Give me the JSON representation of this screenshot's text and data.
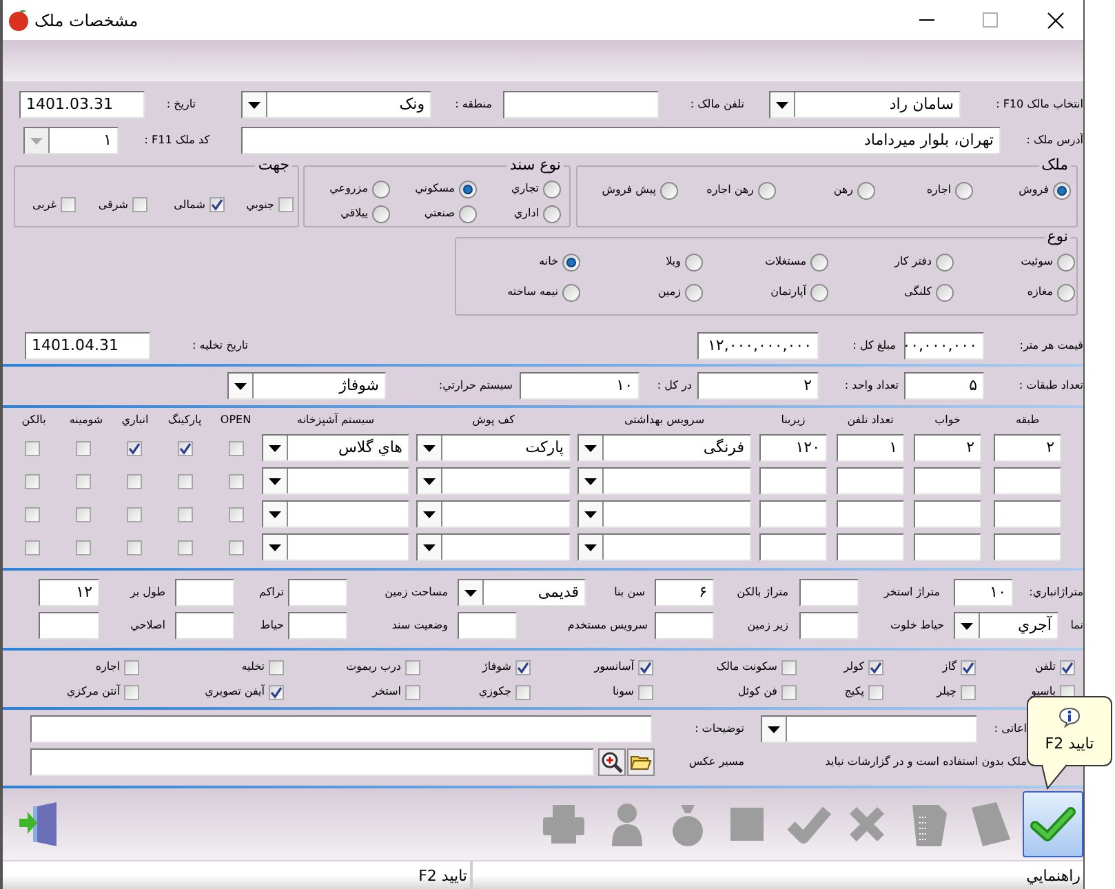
{
  "window": {
    "title": "مشخصات ملک"
  },
  "header": {
    "owner_line": [
      {
        "kind": "label",
        "text": "انتخاب مالک F10 :"
      },
      {
        "kind": "combo",
        "value": "سامان راد"
      },
      {
        "kind": "label",
        "text": "تلفن مالک :"
      },
      {
        "kind": "readonly"
      },
      {
        "kind": "label",
        "text": "منطقه :"
      },
      {
        "kind": "combo",
        "value": "ونک"
      },
      {
        "kind": "label",
        "text": "تاریخ :"
      },
      {
        "kind": "date",
        "value": "1401.03.31"
      }
    ],
    "address_line": [
      {
        "kind": "label",
        "text": "آدرس ملک :"
      },
      {
        "kind": "field",
        "value": "تهران، بلوار میرداماد"
      },
      {
        "kind": "label",
        "text": "کد ملک F11 :"
      },
      {
        "kind": "code",
        "value": "۱"
      }
    ]
  },
  "deal_group": {
    "title": "ملک",
    "options": [
      {
        "label": "فروش",
        "selected": true
      },
      {
        "label": "اجاره",
        "selected": false
      },
      {
        "label": "رهن",
        "selected": false
      },
      {
        "label": "رهن اجاره",
        "selected": false
      },
      {
        "label": "پیش فروش",
        "selected": false
      }
    ]
  },
  "document_group": {
    "title": "نوع سند",
    "options": [
      {
        "label": "تجاري",
        "selected": false
      },
      {
        "label": "مسکوني",
        "selected": true
      },
      {
        "label": "مزروعي",
        "selected": false
      },
      {
        "label": "اداري",
        "selected": false
      },
      {
        "label": "صنعتي",
        "selected": false
      },
      {
        "label": "ييلاقي",
        "selected": false
      }
    ]
  },
  "direction_group": {
    "title": "جهت",
    "options": [
      {
        "label": "جنوبي",
        "checked": false
      },
      {
        "label": "شمالی",
        "checked": true
      },
      {
        "label": "شرقی",
        "checked": false
      },
      {
        "label": "غربی",
        "checked": false
      }
    ]
  },
  "type_group": {
    "title": "نوع",
    "options": [
      {
        "label": "سوئیت",
        "selected": false
      },
      {
        "label": "دفتر کار",
        "selected": false
      },
      {
        "label": "مستغلات",
        "selected": false
      },
      {
        "label": "ویلا",
        "selected": false
      },
      {
        "label": "خانه",
        "selected": true
      },
      {
        "label": "مغازه",
        "selected": false
      },
      {
        "label": "کلنگی",
        "selected": false
      },
      {
        "label": "آپارتمان",
        "selected": false
      },
      {
        "label": "زمین",
        "selected": false
      },
      {
        "label": "نیمه ساخته",
        "selected": false
      }
    ]
  },
  "price_row": [
    {
      "kind": "label",
      "text": "قیمت هر متر:"
    },
    {
      "kind": "field",
      "value": "۰۰,۰۰۰,۰۰۰"
    },
    {
      "kind": "label",
      "text": "مبلغ کل :"
    },
    {
      "kind": "field",
      "value": "۱۲,۰۰۰,۰۰۰,۰۰۰"
    },
    {
      "kind": "label",
      "text": "تاریخ تخلیه :"
    },
    {
      "kind": "date",
      "value": "1401.04.31"
    }
  ],
  "floor_row": [
    {
      "kind": "label",
      "text": "تعداد طبقات :"
    },
    {
      "kind": "field",
      "value": "۵"
    },
    {
      "kind": "label",
      "text": "تعداد واحد :"
    },
    {
      "kind": "field",
      "value": "۲"
    },
    {
      "kind": "label",
      "text": "در کل :"
    },
    {
      "kind": "field",
      "value": "۱۰"
    },
    {
      "kind": "label",
      "text": "سیستم حرارتي:"
    },
    {
      "kind": "combo",
      "value": "شوفاژ"
    }
  ],
  "grid": {
    "columns": [
      "طبقه",
      "خواب",
      "تعداد تلفن",
      "زیربنا",
      "سرويس بهداشتی",
      "کف پوش",
      "سیستم آشپزخانه",
      "OPEN",
      "پارکینگ",
      "انباري",
      "شومینه",
      "بالکن"
    ],
    "rows": [
      {
        "floor": "۲",
        "bedrooms": "۲",
        "phones": "۱",
        "area": "۱۲۰",
        "bathroom": "فرنگی",
        "flooring": "پارکت",
        "kitchen": "هاي گلاس",
        "open": false,
        "parking": true,
        "storage": true,
        "fireplace": false,
        "balcony": false
      },
      {
        "open": false,
        "parking": false,
        "storage": false,
        "fireplace": false,
        "balcony": false
      },
      {
        "open": false,
        "parking": false,
        "storage": false,
        "fireplace": false,
        "balcony": false
      },
      {
        "open": false,
        "parking": false,
        "storage": false,
        "fireplace": false,
        "balcony": false
      }
    ]
  },
  "details_rows": [
    [
      {
        "kind": "label",
        "text": "متراژانباري:"
      },
      {
        "kind": "field",
        "value": "۱۰"
      },
      {
        "kind": "label",
        "text": "متراژ استخر"
      },
      {
        "kind": "field"
      },
      {
        "kind": "label",
        "text": "متراژ بالکن"
      },
      {
        "kind": "field",
        "value": "۶"
      },
      {
        "kind": "label",
        "text": "سن بنا"
      },
      {
        "kind": "combo",
        "value": "قدیمی"
      },
      {
        "kind": "label",
        "text": "مساحت زمین"
      },
      {
        "kind": "field"
      },
      {
        "kind": "label",
        "text": "تراکم"
      },
      {
        "kind": "field"
      },
      {
        "kind": "label",
        "text": "طول بر"
      },
      {
        "kind": "field",
        "value": "۱۲"
      }
    ],
    [
      {
        "kind": "label",
        "text": "نما"
      },
      {
        "kind": "combo",
        "value": "آجري"
      },
      {
        "kind": "label",
        "text": "حیاط خلوت"
      },
      {
        "kind": "field"
      },
      {
        "kind": "label",
        "text": "زیر زمین"
      },
      {
        "kind": "field"
      },
      {
        "kind": "label",
        "text": "سرويس مستخدم"
      },
      {
        "kind": "field"
      },
      {
        "kind": "label",
        "text": "وضعیت سند"
      },
      {
        "kind": "field"
      },
      {
        "kind": "label",
        "text": "حياط"
      },
      {
        "kind": "field"
      },
      {
        "kind": "label",
        "text": "اصلاحي"
      },
      {
        "kind": "field"
      }
    ]
  ],
  "amenities": [
    {
      "label": "تلفن",
      "checked": true
    },
    {
      "label": "گاز",
      "checked": true
    },
    {
      "label": "کولر",
      "checked": true
    },
    {
      "label": "سکونت مالک",
      "checked": false
    },
    {
      "label": "آسانسور",
      "checked": true
    },
    {
      "label": "شوفاژ",
      "checked": true
    },
    {
      "label": "درب ریموت",
      "checked": false
    },
    {
      "label": "تخلیه",
      "checked": false
    },
    {
      "label": "اجاره",
      "checked": false
    },
    {
      "label": "باسيو",
      "checked": false
    },
    {
      "label": "چیلر",
      "checked": false
    },
    {
      "label": "پکیج",
      "checked": false
    },
    {
      "label": "فن کوئل",
      "checked": false
    },
    {
      "label": "سونا",
      "checked": false
    },
    {
      "label": "جکوزي",
      "checked": false
    },
    {
      "label": "استخر",
      "checked": false
    },
    {
      "label": "آیفن تصويري",
      "checked": true
    },
    {
      "label": "آنتن مرکزي",
      "checked": false
    }
  ],
  "notes_rows": [
    [
      {
        "kind": "label",
        "text": "اعاتی :"
      },
      {
        "kind": "combo"
      },
      {
        "kind": "label",
        "text": "توضیحات :"
      },
      {
        "kind": "field"
      }
    ],
    [
      {
        "kind": "note",
        "text": "ملک بدون استفاده است و در گزارشات نیاید"
      },
      {
        "kind": "label",
        "text": "مسیر عکس"
      },
      {
        "kind": "browse"
      },
      {
        "kind": "preview"
      },
      {
        "kind": "field"
      }
    ]
  ],
  "toolbar": [
    {
      "kind": "confirm",
      "disabled": false,
      "hovered": true
    },
    {
      "kind": "notes",
      "disabled": true,
      "hovered": false
    },
    {
      "kind": "report",
      "disabled": true,
      "hovered": false
    },
    {
      "kind": "delete",
      "disabled": true,
      "hovered": false
    },
    {
      "kind": "approve",
      "disabled": true,
      "hovered": false
    },
    {
      "kind": "stop",
      "disabled": true,
      "hovered": false
    },
    {
      "kind": "money",
      "disabled": true,
      "hovered": false
    },
    {
      "kind": "user",
      "disabled": true,
      "hovered": false
    },
    {
      "kind": "print",
      "disabled": true,
      "hovered": false
    },
    {
      "kind": "exit",
      "disabled": false,
      "hovered": false
    }
  ],
  "tooltip": {
    "text": "تایید F2"
  },
  "status_bar": [
    {
      "text": "راهنمايي"
    },
    {
      "text": "تایید F2"
    }
  ]
}
